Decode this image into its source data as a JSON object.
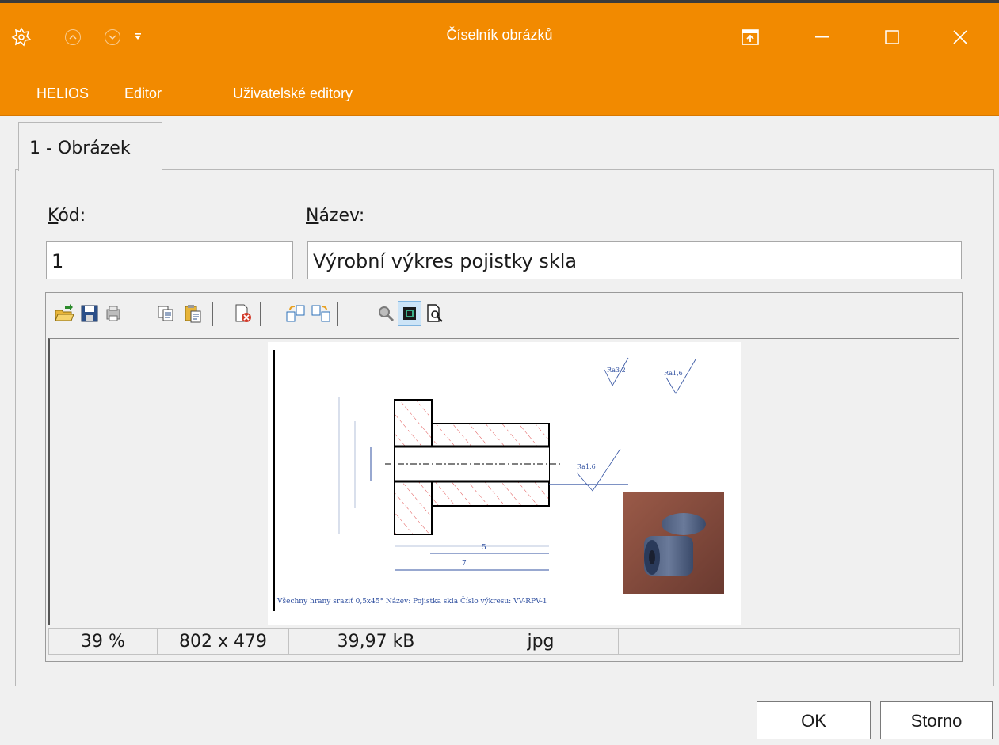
{
  "window": {
    "title": "Číselník obrázků"
  },
  "menu": [
    "HELIOS",
    "Editor",
    "Uživatelské editory"
  ],
  "tab": {
    "label": "1 - Obrázek"
  },
  "form": {
    "kod_label_key": "K",
    "kod_label_rest": "ód:",
    "kod_value": "1",
    "nazev_label_key": "N",
    "nazev_label_rest": "ázev:",
    "nazev_value": "Výrobní výkres pojistky skla"
  },
  "toolbar_icons": [
    "open-folder-icon",
    "save-icon",
    "scan-icon",
    "copy-icon",
    "paste-icon",
    "delete-image-icon",
    "rotate-left-icon",
    "rotate-right-icon",
    "zoom-icon",
    "fit-image-icon",
    "preview-icon"
  ],
  "drawing": {
    "note": "Všechny hrany sraziť 0,5x45°   Název: Pojistka skla    Číslo výkresu: VV-RPV-1",
    "roughness_1": "Ra3,2",
    "roughness_2": "Ra1,6",
    "roughness_3": "Ra1,6",
    "dim_5": "5",
    "dim_7": "7"
  },
  "status": {
    "zoom": "39 %",
    "dimensions": "802 x 479",
    "size": "39,97 kB",
    "format": "jpg"
  },
  "buttons": {
    "ok": "OK",
    "cancel": "Storno"
  },
  "colors": {
    "accent": "#f28a00"
  }
}
